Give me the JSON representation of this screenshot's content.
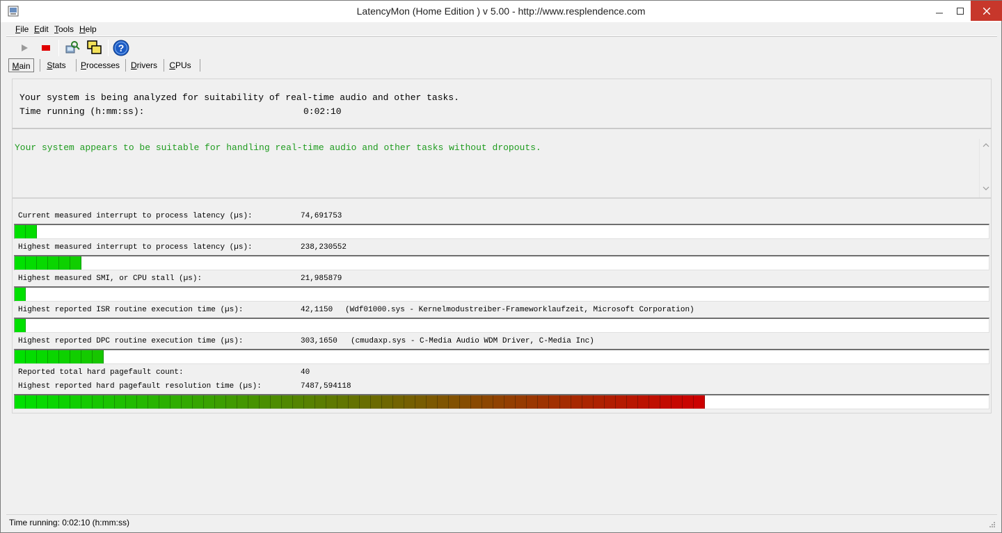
{
  "window": {
    "title": "LatencyMon  (Home Edition )  v 5.00 - http://www.resplendence.com",
    "min_icon": "minimize-icon",
    "max_icon": "maximize-icon",
    "close_icon": "close-icon"
  },
  "menu": [
    {
      "accel": "F",
      "rest": "ile"
    },
    {
      "accel": "E",
      "rest": "dit"
    },
    {
      "accel": "T",
      "rest": "ools"
    },
    {
      "accel": "H",
      "rest": "elp"
    }
  ],
  "toolbar": {
    "items": [
      "play-icon",
      "stop-icon",
      "analyze-icon",
      "windows-icon",
      "help-icon"
    ],
    "colors": {
      "stop": "#e00000",
      "play": "#9a9a9a",
      "help": "#1d5cc5"
    }
  },
  "tabs": [
    {
      "accel": "M",
      "rest": "ain",
      "active": true
    },
    {
      "accel": "S",
      "rest": "tats",
      "active": false
    },
    {
      "accel": "P",
      "rest": "rocesses",
      "active": false
    },
    {
      "accel": "D",
      "rest": "rivers",
      "active": false
    },
    {
      "accel": "C",
      "rest": "PUs",
      "active": false
    }
  ],
  "main": {
    "analysis_line": "Your system is being analyzed for suitability of real-time audio and other tasks.",
    "time_label": "Time running (h:mm:ss):",
    "time_value": "0:02:10",
    "status_message": "Your system appears to be suitable for handling real-time audio and other tasks without dropouts.",
    "status_color": "#1e9b1e"
  },
  "metrics": [
    {
      "label": "Current measured interrupt to process latency (µs):",
      "value": "74,691753",
      "detail": "",
      "bar_segments": 2
    },
    {
      "label": "Highest measured interrupt to process latency (µs):",
      "value": "238,230552",
      "detail": "",
      "bar_segments": 6
    },
    {
      "label": "Highest measured SMI, or CPU stall (µs):",
      "value": "21,985879",
      "detail": "",
      "bar_segments": 1
    },
    {
      "label": "Highest reported ISR routine execution time (µs):",
      "value": "42,1150",
      "detail": "(Wdf01000.sys - Kernelmodustreiber-Frameworklaufzeit, Microsoft Corporation)",
      "bar_segments": 1
    },
    {
      "label": "Highest reported DPC routine execution time (µs):",
      "value": "303,1650",
      "detail": "(cmudaxp.sys - C-Media Audio WDM Driver, C-Media Inc)",
      "bar_segments": 8
    },
    {
      "label": "Reported total hard pagefault count:",
      "value": "40",
      "detail": "",
      "bar_segments": null
    },
    {
      "label": "Highest reported hard pagefault resolution time (µs):",
      "value": "7487,594118",
      "detail": "",
      "bar_segments": 62
    }
  ],
  "bar_colors": {
    "start": "#00e000",
    "end": "#cc0000"
  },
  "statusbar": {
    "text": "Time running: 0:02:10  (h:mm:ss)"
  }
}
